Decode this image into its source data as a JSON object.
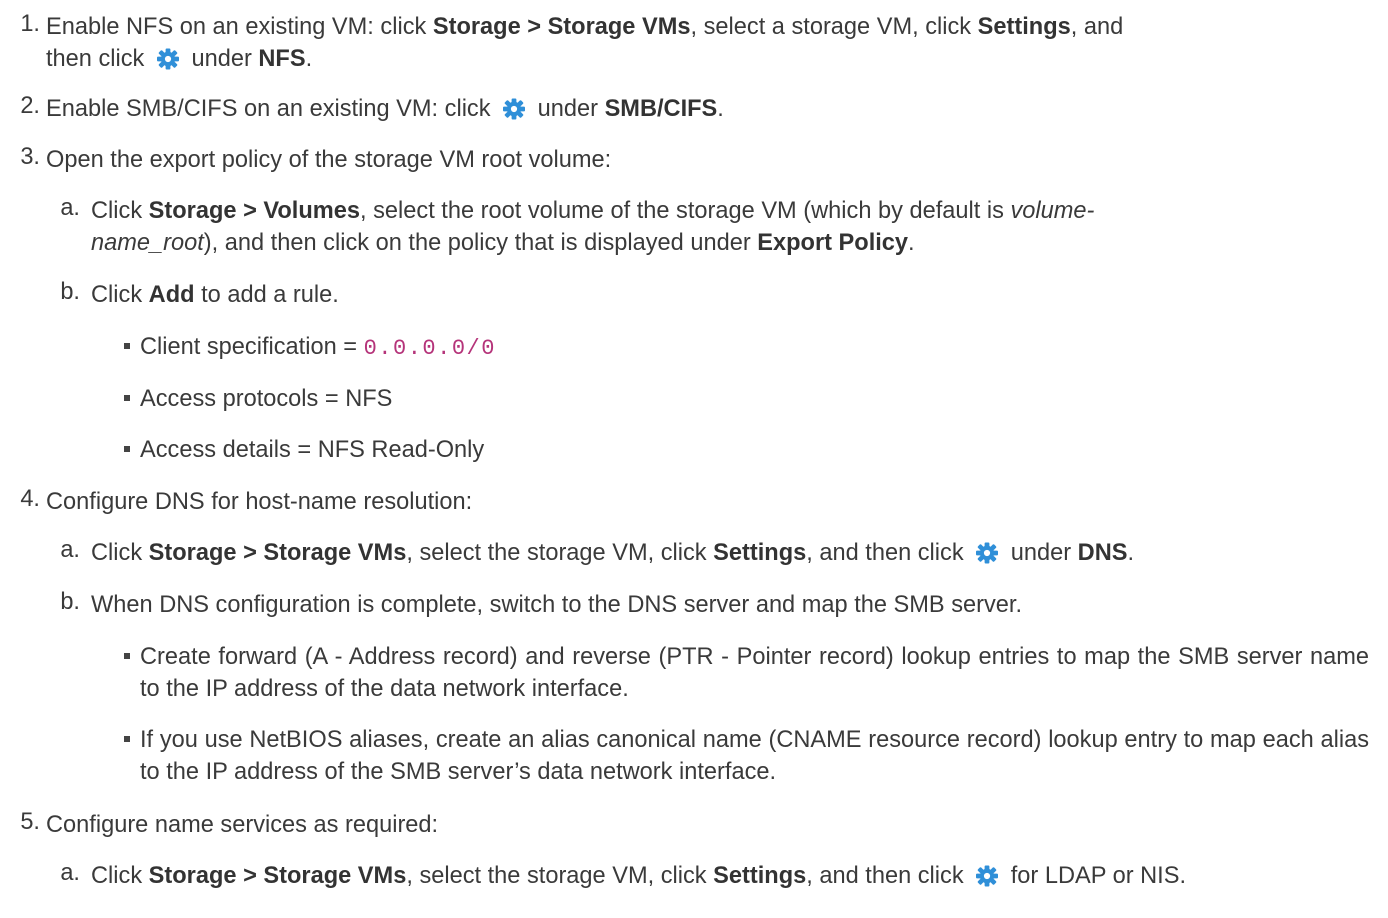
{
  "colors": {
    "text": "#3a3a3a",
    "code": "#b5347a",
    "gear": "#2f8fd8"
  },
  "icons": {
    "gear": "gear-icon"
  },
  "steps": [
    {
      "number": "1.",
      "parts": [
        "Enable NFS on an existing VM: click ",
        "Storage > Storage VMs",
        ", select a storage VM, click ",
        "Settings",
        ", and",
        "then click ",
        " under ",
        "NFS",
        "."
      ]
    },
    {
      "number": "2.",
      "parts": [
        "Enable SMB/CIFS on an existing VM: click ",
        " under ",
        "SMB/CIFS",
        "."
      ]
    },
    {
      "number": "3.",
      "parts": [
        "Open the export policy of the storage VM root volume:"
      ],
      "substeps": [
        {
          "letter": "a.",
          "parts": [
            "Click ",
            "Storage > Volumes",
            ", select the root volume of the storage VM (which by default is ",
            "volume-",
            "name_root",
            "), and then click on the policy that is displayed under ",
            "Export Policy",
            "."
          ]
        },
        {
          "letter": "b.",
          "parts": [
            "Click ",
            "Add",
            " to add a rule."
          ],
          "bullets": [
            {
              "label": "Client specification = ",
              "code": "0.0.0.0/0"
            },
            {
              "label": "Access protocols = NFS"
            },
            {
              "label": "Access details = NFS Read-Only"
            }
          ]
        }
      ]
    },
    {
      "number": "4.",
      "parts": [
        "Configure DNS for host-name resolution:"
      ],
      "substeps": [
        {
          "letter": "a.",
          "parts": [
            "Click ",
            "Storage > Storage VMs",
            ", select the storage VM, click ",
            "Settings",
            ", and then click ",
            " under ",
            "DNS",
            "."
          ]
        },
        {
          "letter": "b.",
          "parts": [
            "When DNS configuration is complete, switch to the DNS server and map the SMB server."
          ],
          "bullets": [
            {
              "label": "Create forward (A - Address record) and reverse (PTR - Pointer record) lookup entries to map the SMB server name to the IP address of the data network interface."
            },
            {
              "label": "If you use NetBIOS aliases, create an alias canonical name (CNAME resource record) lookup entry to map each alias to the IP address of the SMB server’s data network interface."
            }
          ]
        }
      ]
    },
    {
      "number": "5.",
      "parts": [
        "Configure name services as required:"
      ],
      "substeps": [
        {
          "letter": "a.",
          "parts": [
            "Click ",
            "Storage > Storage VMs",
            ", select the storage VM, click ",
            "Settings",
            ", and then click ",
            " for LDAP or NIS."
          ]
        }
      ]
    }
  ]
}
